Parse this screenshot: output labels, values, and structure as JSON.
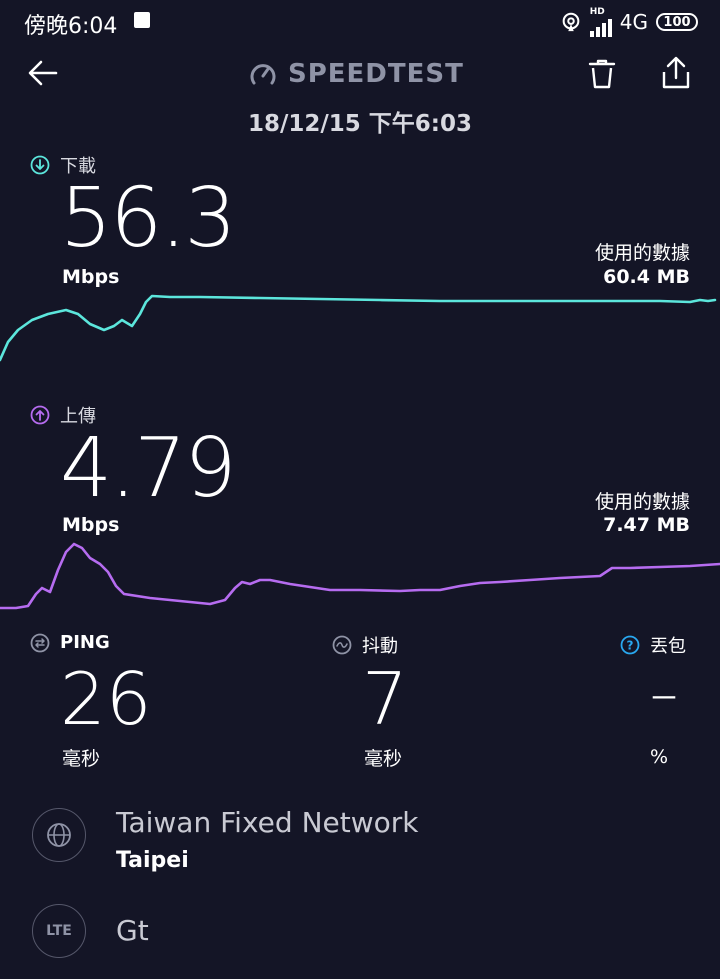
{
  "status_bar": {
    "time": "傍晚6:04",
    "hd": "HD",
    "network": "4G",
    "battery": "100"
  },
  "header": {
    "brand": "SPEEDTEST",
    "datetime": "18/12/15 下午6:03"
  },
  "download": {
    "label": "下載",
    "value": "56.3",
    "unit": "Mbps",
    "data_used_label": "使用的數據",
    "data_used": "60.4 MB",
    "color": "#5ce6dc"
  },
  "upload": {
    "label": "上傳",
    "value": "4.79",
    "unit": "Mbps",
    "data_used_label": "使用的數據",
    "data_used": "7.47 MB",
    "color": "#b66cf0"
  },
  "ping": {
    "label": "PING",
    "value": "26",
    "unit": "毫秒"
  },
  "jitter": {
    "label": "抖動",
    "value": "7",
    "unit": "毫秒"
  },
  "loss": {
    "label": "丟包",
    "value": "–",
    "unit": "%",
    "icon_color": "#29a8f0"
  },
  "provider": {
    "name": "Taiwan Fixed Network",
    "location": "Taipei",
    "connection_icon": "LTE",
    "connection_name": "Gt"
  }
}
